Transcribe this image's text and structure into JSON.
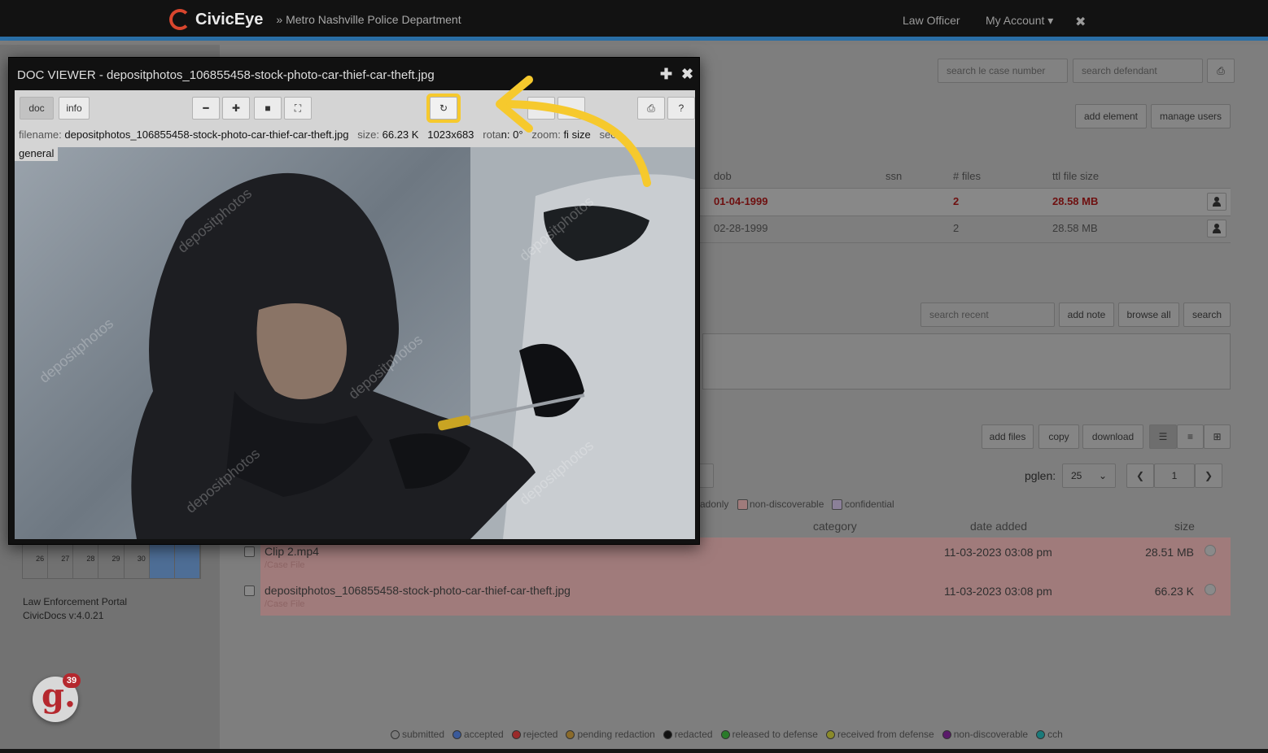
{
  "topbar": {
    "brand_name": "CivicEye",
    "department": "» Metro Nashville Police Department",
    "nav_user": "Law Officer",
    "nav_account": "My Account ▾",
    "close_glyph": "✖"
  },
  "search": {
    "case_placeholder": "search le case number",
    "defendant_placeholder": "search defendant"
  },
  "actions": {
    "add_element": "add element",
    "manage_users": "manage users"
  },
  "defendants_table": {
    "headers": [
      "dob",
      "ssn",
      "# files",
      "ttl file size"
    ],
    "rows": [
      {
        "dob": "01-04-1999",
        "ssn": "",
        "files": "2",
        "size": "28.58 MB"
      },
      {
        "dob": "02-28-1999",
        "ssn": "",
        "files": "2",
        "size": "28.58 MB"
      }
    ]
  },
  "notes": {
    "search_placeholder": "search recent",
    "add_note": "add note",
    "browse_all": "browse all",
    "search": "search"
  },
  "files_toolbar": {
    "add_files": "add files",
    "copy": "copy",
    "download": "download",
    "pglen_label": "pglen:",
    "pglen_value": "25",
    "page_value": "1"
  },
  "flags": {
    "readonly": "adonly",
    "non_discoverable": "non-discoverable",
    "confidential": "confidential"
  },
  "files_table": {
    "headers": {
      "category": "category",
      "date_added": "date added",
      "size": "size"
    },
    "rows": [
      {
        "name": "Clip 2.mp4",
        "path": "/Case File",
        "date": "11-03-2023 03:08 pm",
        "size": "28.51 MB"
      },
      {
        "name": "depositphotos_106855458-stock-photo-car-thief-car-theft.jpg",
        "path": "/Case File",
        "date": "11-03-2023 03:08 pm",
        "size": "66.23 K"
      }
    ]
  },
  "calendar": {
    "days": [
      "26",
      "27",
      "28",
      "29",
      "30",
      "",
      ""
    ]
  },
  "sidebar_footer": {
    "portal": "Law Enforcement Portal",
    "version": "CivicDocs v:4.0.21"
  },
  "badge": {
    "letter": "g.",
    "count": "39"
  },
  "legend": [
    {
      "label": "submitted",
      "color": "#7a7a7a"
    },
    {
      "label": "accepted",
      "color": "#3a5a9a"
    },
    {
      "label": "rejected",
      "color": "#9a2a2a"
    },
    {
      "label": "pending redaction",
      "color": "#8a6a2a"
    },
    {
      "label": "redacted",
      "color": "#111111"
    },
    {
      "label": "released to defense",
      "color": "#2a7a2a"
    },
    {
      "label": "received from defense",
      "color": "#8a8a2a"
    },
    {
      "label": "non-discoverable",
      "color": "#5a1a6a"
    },
    {
      "label": "cch",
      "color": "#1a7a7a"
    }
  ],
  "viewer": {
    "title": "DOC VIEWER - depositphotos_106855458-stock-photo-car-thief-car-theft.jpg",
    "tab_doc": "doc",
    "tab_info": "info",
    "help": "?",
    "info_filename_label": "filename:",
    "info_filename": "depositphotos_106855458-stock-photo-car-thief-car-theft.jpg",
    "info_size_label": "size:",
    "info_size": "66.23 K",
    "info_dims": "1023x683",
    "info_rotation_label": "rota",
    "info_rotation": "n: 0°",
    "info_zoom_label": "zoom:",
    "info_zoom": "fi",
    "info_zoom_rest": "size",
    "info_sec_label": "sec:",
    "info_sec": "general",
    "watermark": "depositphotos"
  },
  "colors": {
    "brand_accent": "#d9462e",
    "highlight": "#f6c92d",
    "row_highlight": "#a07b7b"
  }
}
